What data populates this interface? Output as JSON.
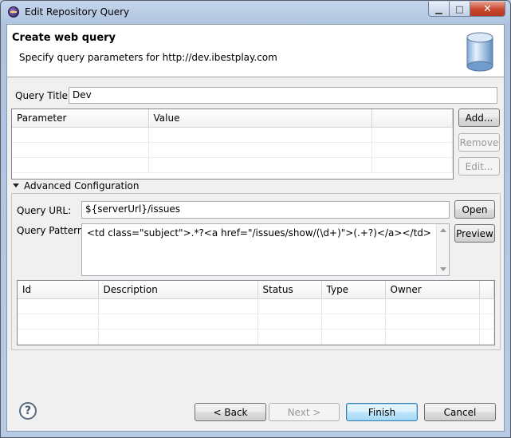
{
  "window": {
    "title": "Edit Repository Query",
    "min_label": "▁",
    "max_label": "□",
    "close_label": "✕"
  },
  "header": {
    "title": "Create web query",
    "description": "Specify query parameters for http://dev.ibestplay.com"
  },
  "query_title": {
    "label": "Query Title:",
    "value": "Dev"
  },
  "parameters_table": {
    "columns": [
      "Parameter",
      "Value",
      ""
    ],
    "rows": [
      [
        "",
        "",
        ""
      ],
      [
        "",
        "",
        ""
      ],
      [
        "",
        "",
        ""
      ]
    ]
  },
  "param_buttons": {
    "add": "Add...",
    "remove": "Remove",
    "edit": "Edit..."
  },
  "advanced": {
    "label": "Advanced Configuration",
    "query_url": {
      "label": "Query URL:",
      "value": "${serverUrl}/issues"
    },
    "open_button": "Open",
    "query_pattern": {
      "label": "Query Pattern:",
      "value": "<td class=\"subject\">.*?<a href=\"/issues/show/(\\d+)\">(.+?)</a></td>"
    },
    "preview_button": "Preview"
  },
  "results_table": {
    "columns": [
      "Id",
      "Description",
      "Status",
      "Type",
      "Owner",
      ""
    ],
    "rows": [
      [
        "",
        "",
        "",
        "",
        "",
        ""
      ],
      [
        "",
        "",
        "",
        "",
        "",
        ""
      ],
      [
        "",
        "",
        "",
        "",
        "",
        ""
      ]
    ]
  },
  "footer": {
    "back": "< Back",
    "next": "Next >",
    "finish": "Finish",
    "cancel": "Cancel",
    "help_icon": "?"
  },
  "colors": {
    "accent": "#3c7fb1",
    "disabled_text": "#9a9a9a"
  }
}
